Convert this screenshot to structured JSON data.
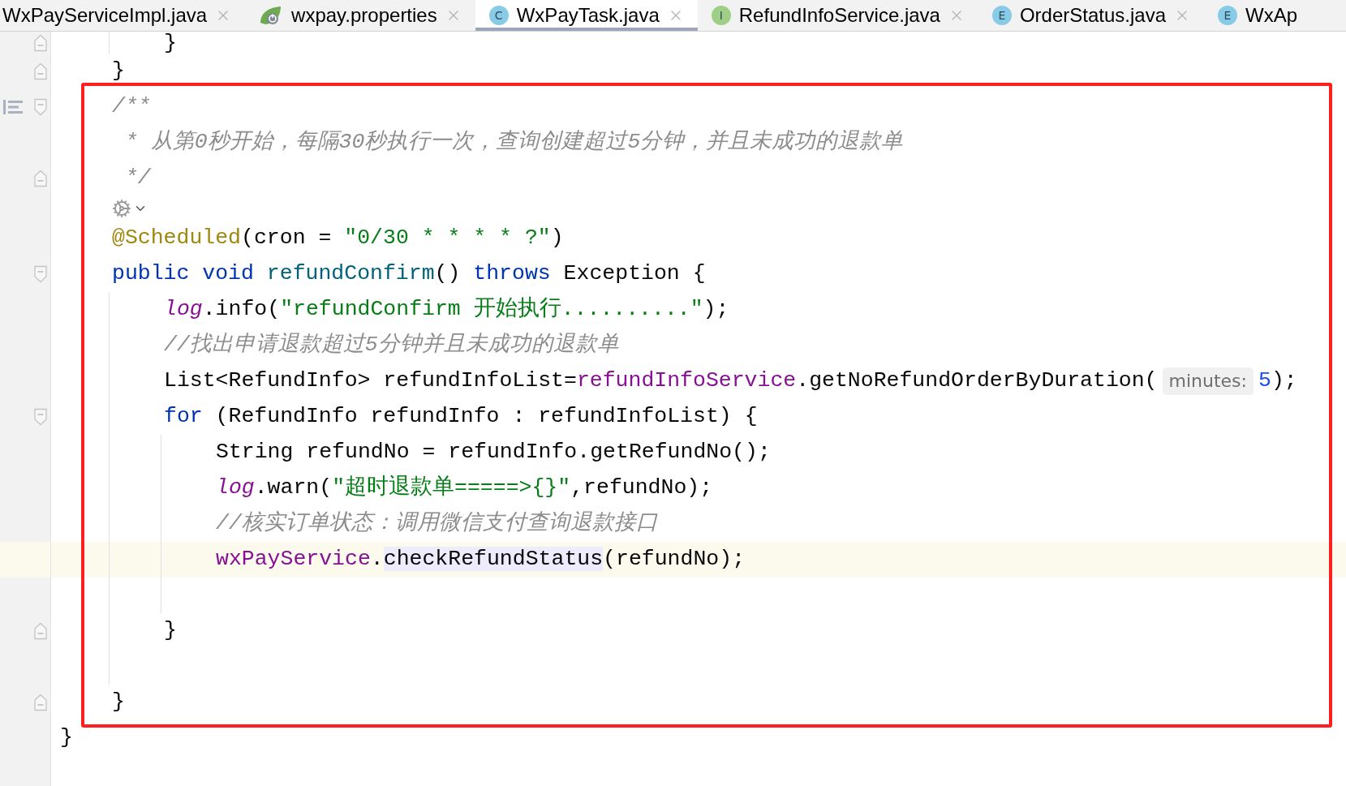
{
  "tabs": [
    {
      "label": "WxPayServiceImpl.java",
      "kind": "plain",
      "closable": true,
      "selected": false
    },
    {
      "label": "wxpay.properties",
      "kind": "properties",
      "closable": true,
      "selected": false
    },
    {
      "label": "WxPayTask.java",
      "kind": "letter",
      "letter": "C",
      "color": "#87cbe6",
      "closable": true,
      "selected": true
    },
    {
      "label": "RefundInfoService.java",
      "kind": "letter",
      "letter": "I",
      "color": "#9fcf86",
      "closable": true,
      "selected": false
    },
    {
      "label": "OrderStatus.java",
      "kind": "letter",
      "letter": "E",
      "color": "#87cbe6",
      "closable": true,
      "selected": false
    },
    {
      "label": "WxAp",
      "kind": "letter",
      "letter": "E",
      "color": "#87cbe6",
      "closable": false,
      "selected": false
    }
  ],
  "editor": {
    "highlight_frame": true,
    "lines": [
      {
        "kind": "group",
        "children": [
          {
            "kind": "group",
            "guide": true,
            "children": [
              {
                "kind": "code",
                "fold_open": false,
                "fold_close": true,
                "doc_toggle": false,
                "current": false,
                "tokens": [
                  {
                    "kind": "plain",
                    "text": "}"
                  }
                ]
              }
            ]
          },
          {
            "kind": "code",
            "fold_open": false,
            "fold_close": true,
            "doc_toggle": false,
            "current": false,
            "tokens": [
              {
                "kind": "plain",
                "text": "}"
              }
            ]
          },
          {
            "kind": "code",
            "fold_open": true,
            "fold_close": false,
            "doc_toggle": true,
            "current": false,
            "tokens": [
              {
                "kind": "comment",
                "text": "/**"
              }
            ]
          },
          {
            "kind": "code",
            "fold_open": false,
            "fold_close": false,
            "doc_toggle": false,
            "current": false,
            "tokens": [
              {
                "kind": "doc",
                "text": "* 从第0秒开始，每隔30秒执行一次，查询创建超过5分钟，并且未成功的退款单"
              }
            ]
          },
          {
            "kind": "code",
            "fold_open": false,
            "fold_close": true,
            "doc_toggle": false,
            "current": false,
            "tokens": [
              {
                "kind": "doc",
                "text": "*/"
              }
            ]
          },
          {
            "kind": "inlay"
          },
          {
            "kind": "code",
            "fold_open": false,
            "fold_close": false,
            "doc_toggle": false,
            "current": false,
            "tokens": [
              {
                "kind": "annotation",
                "text": "@Scheduled"
              },
              {
                "kind": "plain",
                "text": "(cron = "
              },
              {
                "kind": "string",
                "text": "\"0/30 * * * * ?\""
              },
              {
                "kind": "plain",
                "text": ")"
              }
            ]
          },
          {
            "kind": "code",
            "fold_open": true,
            "fold_close": false,
            "doc_toggle": false,
            "current": false,
            "tokens": [
              {
                "kind": "keyword",
                "text": "public void "
              },
              {
                "kind": "decl",
                "text": "refundConfirm"
              },
              {
                "kind": "plain",
                "text": "() "
              },
              {
                "kind": "keyword",
                "text": "throws"
              },
              {
                "kind": "plain",
                "text": " Exception {"
              }
            ],
            "guide": true,
            "children": [
              {
                "kind": "code",
                "fold_open": false,
                "fold_close": false,
                "doc_toggle": false,
                "current": false,
                "tokens": [
                  {
                    "kind": "static",
                    "text": "log"
                  },
                  {
                    "kind": "plain",
                    "text": ".info("
                  },
                  {
                    "kind": "string",
                    "text": "\"refundConfirm 开始执行..........\""
                  },
                  {
                    "kind": "plain",
                    "text": ");"
                  }
                ]
              },
              {
                "kind": "code",
                "fold_open": false,
                "fold_close": false,
                "doc_toggle": false,
                "current": false,
                "tokens": [
                  {
                    "kind": "comment",
                    "text": "//找出申请退款超过5分钟并且未成功的退款单"
                  }
                ]
              },
              {
                "kind": "code",
                "fold_open": false,
                "fold_close": false,
                "doc_toggle": false,
                "current": false,
                "tokens": [
                  {
                    "kind": "plain",
                    "text": "List<RefundInfo> refundInfoList="
                  },
                  {
                    "kind": "field",
                    "text": "refundInfoService"
                  },
                  {
                    "kind": "plain",
                    "text": ".getNoRefundOrderByDuration("
                  },
                  {
                    "kind": "hint",
                    "text": "minutes:"
                  },
                  {
                    "kind": "number",
                    "text": "5"
                  },
                  {
                    "kind": "plain",
                    "text": ");"
                  }
                ]
              },
              {
                "kind": "code",
                "fold_open": true,
                "fold_close": false,
                "doc_toggle": false,
                "current": false,
                "tokens": [
                  {
                    "kind": "keyword",
                    "text": "for"
                  },
                  {
                    "kind": "plain",
                    "text": " (RefundInfo refundInfo : refundInfoList) {"
                  }
                ],
                "guide": true,
                "children": [
                  {
                    "kind": "code",
                    "fold_open": false,
                    "fold_close": false,
                    "doc_toggle": false,
                    "current": false,
                    "tokens": [
                      {
                        "kind": "plain",
                        "text": "String refundNo = refundInfo.getRefundNo();"
                      }
                    ]
                  },
                  {
                    "kind": "code",
                    "fold_open": false,
                    "fold_close": false,
                    "doc_toggle": false,
                    "current": false,
                    "tokens": [
                      {
                        "kind": "static",
                        "text": "log"
                      },
                      {
                        "kind": "plain",
                        "text": ".warn("
                      },
                      {
                        "kind": "string",
                        "text": "\"超时退款单=====>{}\""
                      },
                      {
                        "kind": "plain",
                        "text": ",refundNo);"
                      }
                    ]
                  },
                  {
                    "kind": "code",
                    "fold_open": false,
                    "fold_close": false,
                    "doc_toggle": false,
                    "current": false,
                    "tokens": [
                      {
                        "kind": "comment",
                        "text": "//核实订单状态：调用微信支付查询退款接口"
                      }
                    ]
                  },
                  {
                    "kind": "code",
                    "fold_open": false,
                    "fold_close": false,
                    "doc_toggle": false,
                    "current": true,
                    "tokens": [
                      {
                        "kind": "field",
                        "text": "wxPayService"
                      },
                      {
                        "kind": "plain",
                        "text": "."
                      },
                      {
                        "kind": "usage",
                        "text": "checkRefundStatus"
                      },
                      {
                        "kind": "plain",
                        "text": "(refundNo);"
                      }
                    ]
                  },
                  {
                    "kind": "blank"
                  }
                ]
              },
              {
                "kind": "code",
                "fold_open": false,
                "fold_close": true,
                "doc_toggle": false,
                "current": false,
                "tokens": [
                  {
                    "kind": "plain",
                    "text": "}"
                  }
                ]
              },
              {
                "kind": "blank"
              }
            ]
          },
          {
            "kind": "code",
            "fold_open": false,
            "fold_close": true,
            "doc_toggle": false,
            "current": false,
            "tokens": [
              {
                "kind": "plain",
                "text": "}"
              }
            ]
          }
        ]
      },
      {
        "kind": "code",
        "fold_open": false,
        "fold_close": false,
        "doc_toggle": false,
        "current": false,
        "tokens": [
          {
            "kind": "plain",
            "text": "}"
          }
        ]
      }
    ]
  }
}
